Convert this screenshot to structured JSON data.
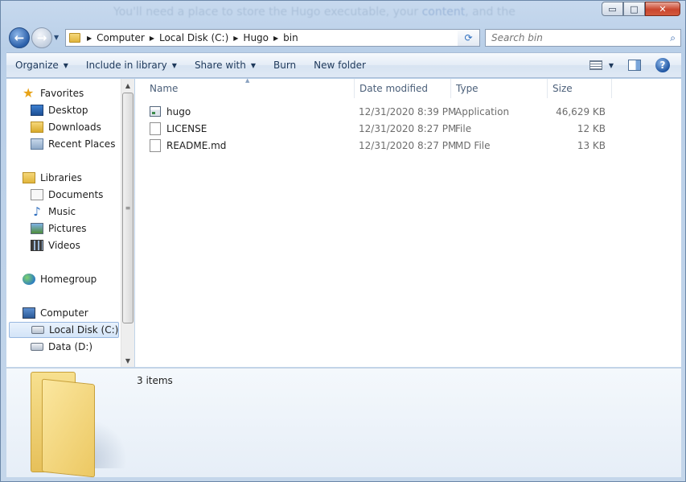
{
  "background_text": {
    "before": "You'll need a place to store the Hugo executable, your",
    "link": "content",
    "after": ", and the"
  },
  "window_controls": {
    "minimize": "▭",
    "maximize": "□",
    "close": "✕"
  },
  "navigation": {
    "back": "←",
    "forward": "→",
    "history_dropdown": "▼"
  },
  "address_bar": {
    "crumbs": [
      "Computer",
      "Local Disk (C:)",
      "Hugo",
      "bin"
    ],
    "dropdown": "▼",
    "refresh": "⟳"
  },
  "search": {
    "placeholder": "Search bin",
    "icon": "⌕"
  },
  "toolbar": {
    "organize": "Organize",
    "include_in_library": "Include in library",
    "share_with": "Share with",
    "burn": "Burn",
    "new_folder": "New folder",
    "dropdown": "▼",
    "help": "?"
  },
  "nav_pane": {
    "favorites": "Favorites",
    "desktop": "Desktop",
    "downloads": "Downloads",
    "recent_places": "Recent Places",
    "libraries": "Libraries",
    "documents": "Documents",
    "music": "Music",
    "pictures": "Pictures",
    "videos": "Videos",
    "homegroup": "Homegroup",
    "computer": "Computer",
    "local_disk": "Local Disk (C:)",
    "data_drive": "Data (D:)",
    "selected": "Local Disk (C:)"
  },
  "columns": {
    "name": "Name",
    "date_modified": "Date modified",
    "type": "Type",
    "size": "Size"
  },
  "files": [
    {
      "name": "hugo",
      "date": "12/31/2020 8:39 PM",
      "type": "Application",
      "size": "46,629 KB",
      "icon": "application-icon"
    },
    {
      "name": "LICENSE",
      "date": "12/31/2020 8:27 PM",
      "type": "File",
      "size": "12 KB",
      "icon": "file-icon"
    },
    {
      "name": "README.md",
      "date": "12/31/2020 8:27 PM",
      "type": "MD File",
      "size": "13 KB",
      "icon": "file-icon"
    }
  ],
  "details_pane": {
    "item_count": "3 items"
  }
}
